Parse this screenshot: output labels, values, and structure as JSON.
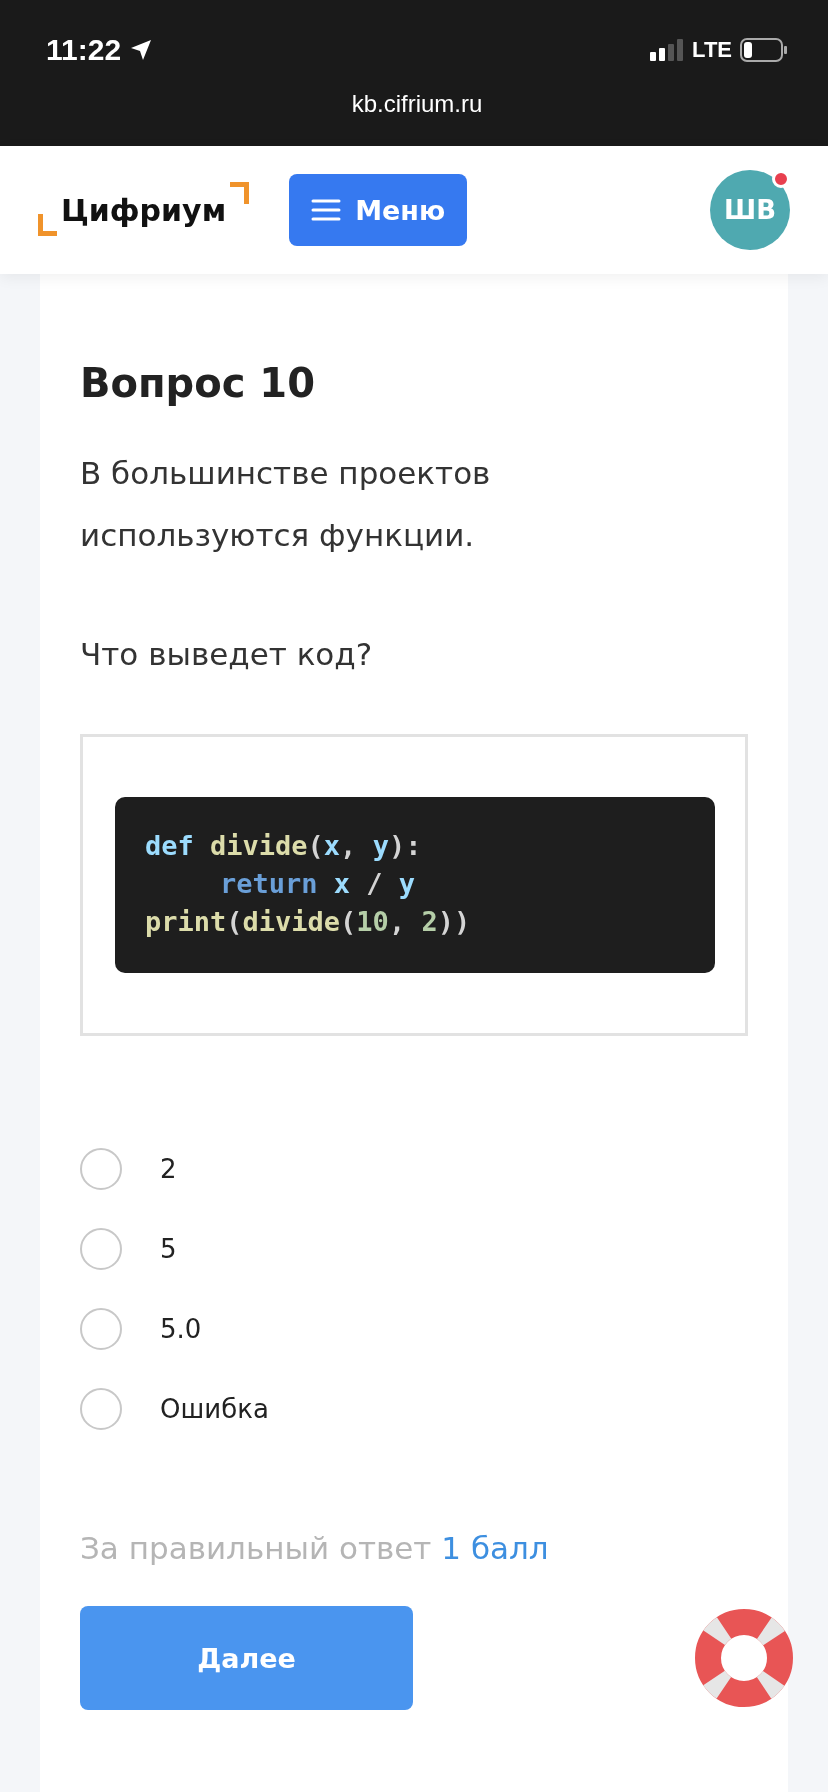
{
  "status_bar": {
    "time": "11:22",
    "network": "LTE",
    "url": "kb.cifrium.ru"
  },
  "header": {
    "logo": "Цифриум",
    "menu_button": "Меню",
    "avatar": {
      "initials": "ШВ",
      "notification": true
    }
  },
  "question": {
    "title": "Вопрос 10",
    "text": "В большинстве проектов используются функции.",
    "prompt": "Что выведет код?",
    "code": [
      {
        "indented": false,
        "tokens": [
          {
            "text": "def ",
            "kind": "keyword"
          },
          {
            "text": "divide",
            "kind": "function"
          },
          {
            "text": "(",
            "kind": "punct"
          },
          {
            "text": "x",
            "kind": "param"
          },
          {
            "text": ", ",
            "kind": "punct"
          },
          {
            "text": "y",
            "kind": "param"
          },
          {
            "text": "):",
            "kind": "punct"
          }
        ]
      },
      {
        "indented": true,
        "tokens": [
          {
            "text": "return ",
            "kind": "control"
          },
          {
            "text": "x",
            "kind": "param"
          },
          {
            "text": " / ",
            "kind": "punct"
          },
          {
            "text": "y",
            "kind": "param"
          }
        ]
      },
      {
        "indented": false,
        "tokens": [
          {
            "text": "print",
            "kind": "function"
          },
          {
            "text": "(",
            "kind": "punct"
          },
          {
            "text": "divide",
            "kind": "function"
          },
          {
            "text": "(",
            "kind": "punct"
          },
          {
            "text": "10",
            "kind": "number"
          },
          {
            "text": ", ",
            "kind": "punct"
          },
          {
            "text": "2",
            "kind": "number"
          },
          {
            "text": "))",
            "kind": "punct"
          }
        ]
      }
    ],
    "options": [
      {
        "label": "2",
        "selected": false
      },
      {
        "label": "5",
        "selected": false
      },
      {
        "label": "5.0",
        "selected": false
      },
      {
        "label": "Ошибка",
        "selected": false
      }
    ],
    "score_label": "За правильный ответ",
    "score_value": "1 балл",
    "next_button": "Далее"
  }
}
